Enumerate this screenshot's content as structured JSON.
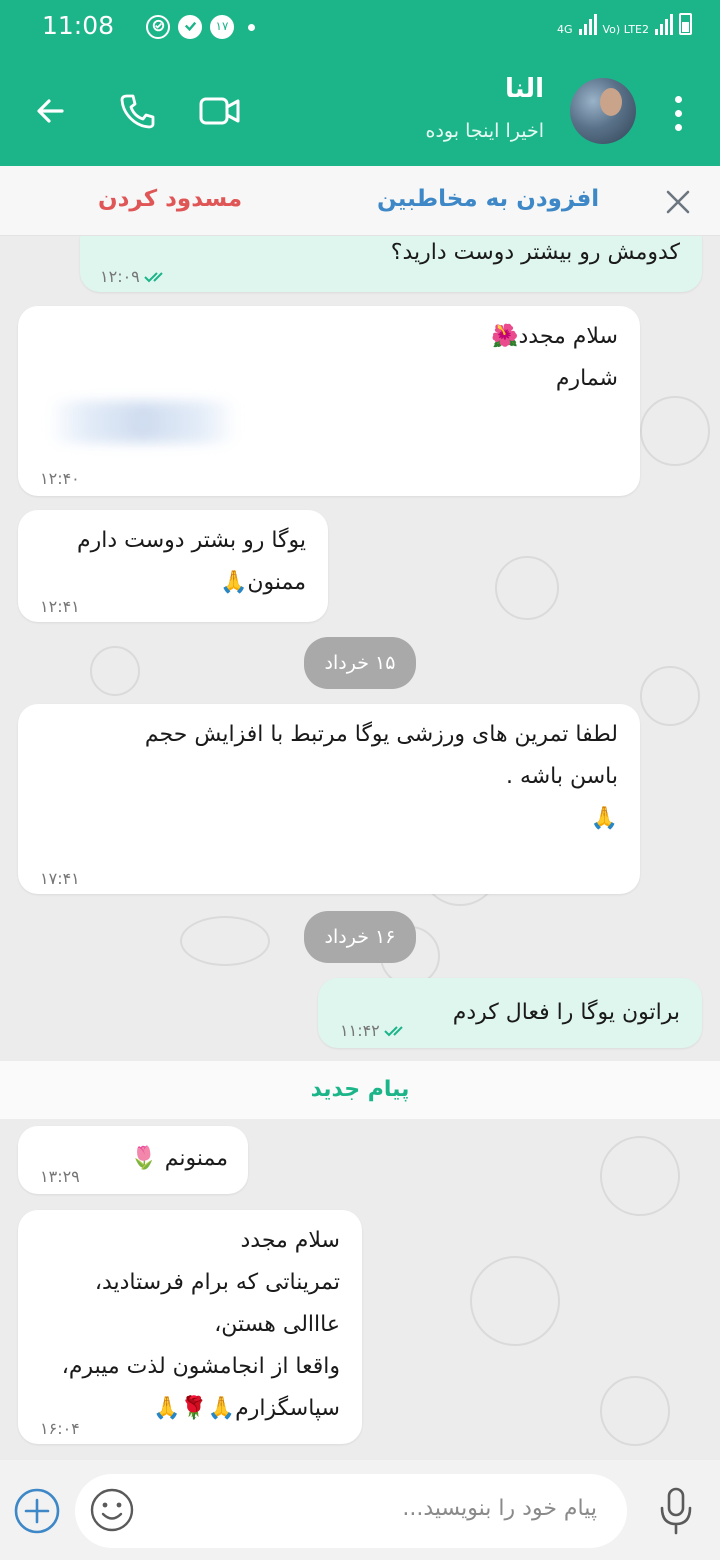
{
  "status_bar": {
    "time": "11:08",
    "badge_count": "۱۷",
    "network_left": "4G",
    "network_right": "Vo) LTE2"
  },
  "header": {
    "contact_name": "النا",
    "contact_status": "اخیرا اینجا بوده"
  },
  "actions": {
    "block_label": "مسدود کردن",
    "add_contact_label": "افزودن به مخاطبین"
  },
  "messages": [
    {
      "direction": "out",
      "text": "کدومش رو بیشتر دوست دارید؟",
      "time": "۱۲:۰۹",
      "read": true
    },
    {
      "direction": "in",
      "text": "سلام مجدد🌺\nشمارم",
      "time": "۱۲:۴۰"
    },
    {
      "direction": "in",
      "text": "یوگا رو بشتر دوست دارم\nممنون🙏",
      "time": "۱۲:۴۱"
    },
    {
      "direction": "in",
      "text": "لطفا تمرین های ورزشی یوگا مرتبط با افزایش حجم\nباسن باشه .\n🙏",
      "time": "۱۷:۴۱"
    },
    {
      "direction": "out",
      "text": "براتون یوگا را فعال کردم",
      "time": "۱۱:۴۲",
      "read": true
    },
    {
      "direction": "in",
      "text": "ممنونم 🌷",
      "time": "۱۳:۲۹"
    },
    {
      "direction": "in",
      "text": "سلام مجدد\nتمریناتی که برام فرستادید،\nعااالی هستن،\nواقعا از انجامشون لذت میبرم،\nسپاسگزارم🙏🌹🙏",
      "time": "۱۶:۰۴"
    }
  ],
  "date_chips": [
    "۱۵ خرداد",
    "۱۶ خرداد"
  ],
  "new_messages_label": "پیام جدید",
  "composer": {
    "placeholder": "پیام خود را بنویسید..."
  },
  "colors": {
    "brand": "#1cb589",
    "outgoing_bubble": "#dff6ef",
    "block_red": "#e05555",
    "add_blue": "#3e88c7"
  }
}
